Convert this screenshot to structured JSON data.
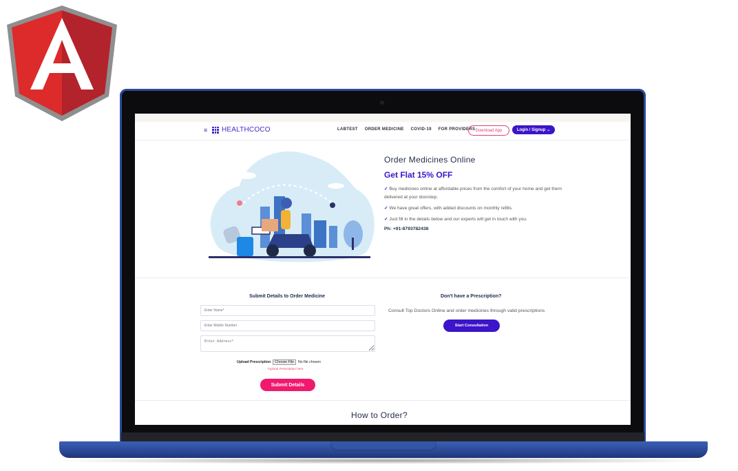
{
  "nav": {
    "menu_icon": "hamburger-icon",
    "brand": "HEALTHCOCO",
    "links": [
      "LABTEST",
      "ORDER MEDICINE",
      "COVID-19",
      "FOR PROVIDERS"
    ],
    "download_app": "Download App",
    "login_signup": "Login / Signup ⌄"
  },
  "hero": {
    "title": "Order Medicines Online",
    "offer": "Get Flat 15% OFF",
    "check_icon": "✓",
    "points": [
      "Buy medicines online at affordable prices from the comfort of your home and get them delivered at your doorstep.",
      "We have great offers, with added discounts on monthly refills.",
      "Just fill in the details below and our experts will get in touch with you."
    ],
    "phone": "Ph: +91-8793782438"
  },
  "order_form": {
    "title": "Submit Details to Order Medicine",
    "name_placeholder": "Enter Name*",
    "mobile_placeholder": "Enter Mobile Number",
    "address_placeholder": "Enter Address*",
    "upload_label": "Upload Prescription",
    "choose_file": "Choose File",
    "no_file": "No file chosen",
    "upload_hint": "*Upload Prescription here.",
    "submit": "Submit Details"
  },
  "prescription": {
    "title": "Don't have a Prescription?",
    "text": "Consult Top Doctors Online and order medicines through valid prescriptions",
    "button": "Start Consultation"
  },
  "how_to": {
    "title": "How to Order?"
  },
  "colors": {
    "brand_purple": "#3c14c9",
    "accent_pink": "#f0196e",
    "laptop_blue": "#2b4896",
    "angular_red": "#dd0031"
  }
}
